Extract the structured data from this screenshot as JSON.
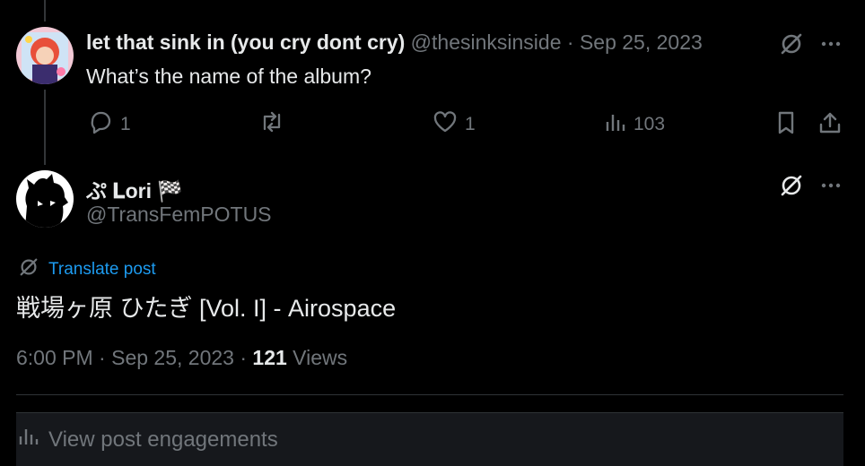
{
  "reply": {
    "display_name": "let that sink in (you cry dont cry)",
    "handle": "@thesinksinside",
    "separator": "·",
    "date": "Sep 25, 2023",
    "text": "What’s the name of the album?",
    "actions": {
      "replies": "1",
      "reposts": "",
      "likes": "1",
      "views": "103"
    }
  },
  "main": {
    "display_name": "ぷ 𝐋ori 🏁",
    "handle": "@TransFemPOTUS",
    "translate_label": "Translate post",
    "text": "戦場ヶ原 ひたぎ [Vol. I] - Airospace",
    "time": "6:00 PM",
    "separator": "·",
    "date": "Sep 25, 2023",
    "separator2": "·",
    "views_count": "121",
    "views_label": "Views"
  },
  "engagements": {
    "label": "View post engagements"
  },
  "icons": {
    "grok": "grok-icon",
    "more": "more-icon",
    "reply": "reply-icon",
    "repost": "repost-icon",
    "like": "like-icon",
    "views": "views-icon",
    "bookmark": "bookmark-icon",
    "share": "share-icon"
  },
  "colors": {
    "background": "#000000",
    "text": "#e7e9ea",
    "muted": "#71767b",
    "link": "#1d9bf0",
    "divider": "#2f3336"
  }
}
